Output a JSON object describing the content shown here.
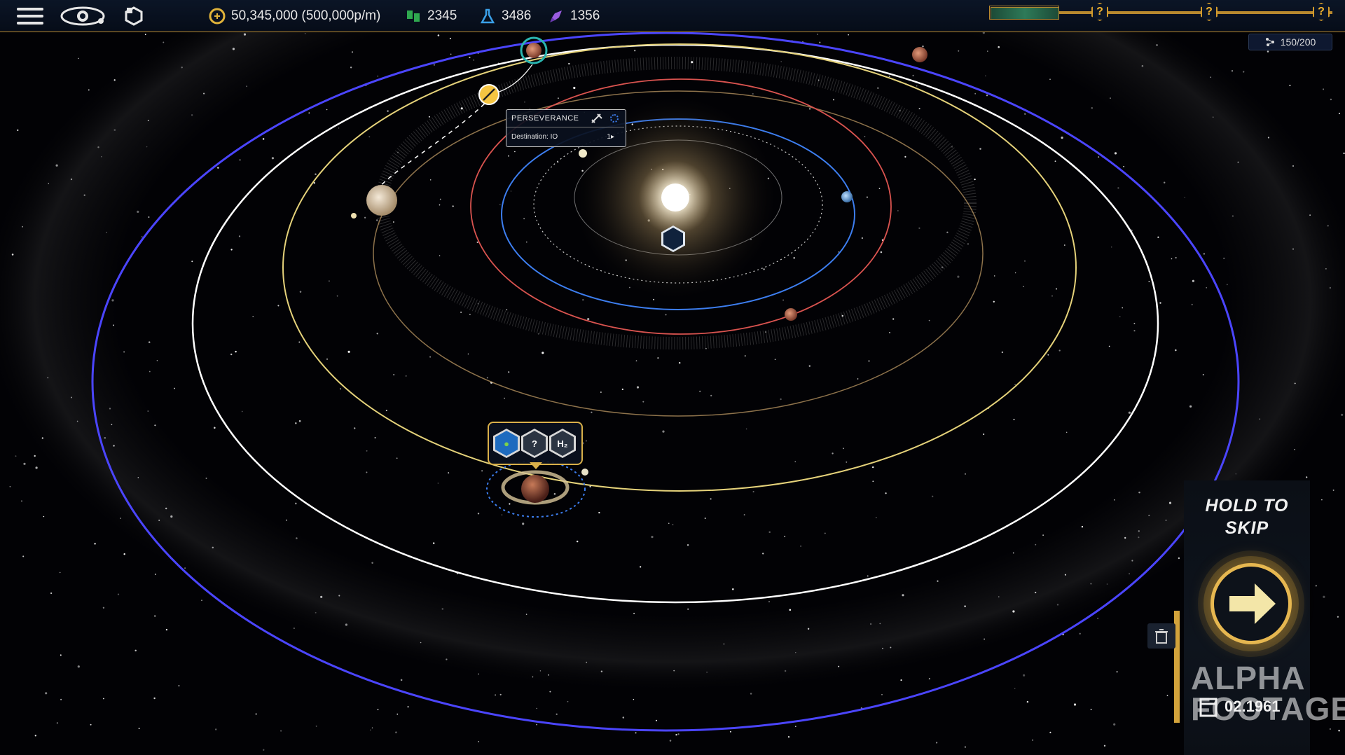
{
  "topbar": {
    "menu_icon": "hamburger-menu-icon",
    "view_icon": "eye-icon",
    "hex_icon": "hexagon-icon",
    "money": "50,345,000 (500,000p/m)",
    "approval": "2345",
    "science": "3486",
    "rockets": "1356",
    "milestones": [
      "?",
      "?",
      "?"
    ]
  },
  "progress": {
    "fraction": 0.16
  },
  "slots": {
    "value": "150/200"
  },
  "tooltip": {
    "name": "PERSEVERANCE",
    "destination": "Destination: IO",
    "speed": "1▸"
  },
  "popup": {
    "items": [
      "earth-like-icon",
      "?",
      "H₂"
    ]
  },
  "skip": {
    "label": "HOLD TO SKIP",
    "line1": "HOLD TO",
    "line2": "SKIP"
  },
  "footer": {
    "date": "02.1961",
    "watermark_line1": "ALPHA",
    "watermark_line2": "FOOTAGE"
  },
  "colors": {
    "accent_gold": "#d29b2c",
    "orbit_blue": "#4b45ff",
    "orbit_white": "#ffffff",
    "orbit_yellow": "#e5d27a",
    "orbit_red": "#d9534f",
    "orbit_cyan": "#3d7ef0",
    "progress_green": "#2e7a58"
  }
}
